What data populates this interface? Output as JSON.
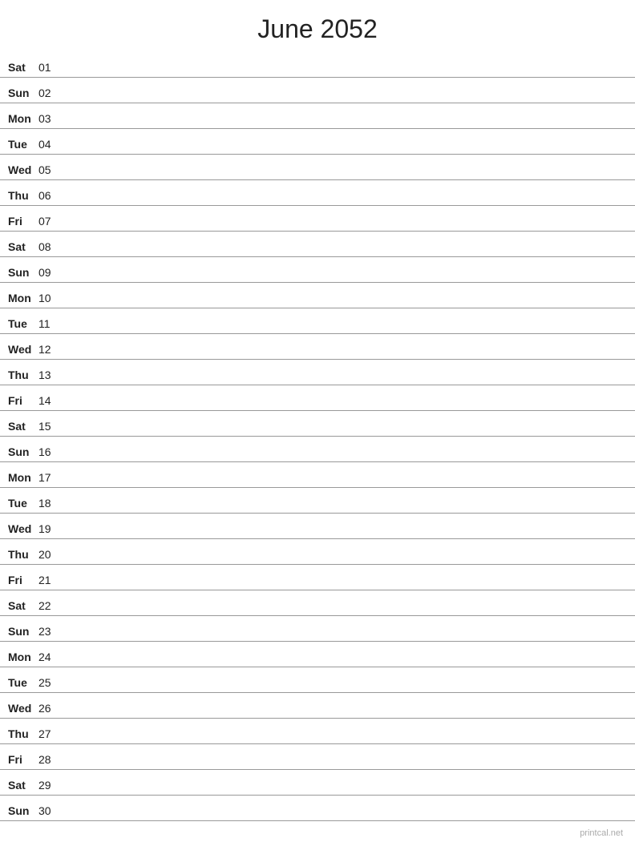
{
  "header": {
    "title": "June 2052"
  },
  "footer": {
    "text": "printcal.net"
  },
  "days": [
    {
      "day": "Sat",
      "num": "01"
    },
    {
      "day": "Sun",
      "num": "02"
    },
    {
      "day": "Mon",
      "num": "03"
    },
    {
      "day": "Tue",
      "num": "04"
    },
    {
      "day": "Wed",
      "num": "05"
    },
    {
      "day": "Thu",
      "num": "06"
    },
    {
      "day": "Fri",
      "num": "07"
    },
    {
      "day": "Sat",
      "num": "08"
    },
    {
      "day": "Sun",
      "num": "09"
    },
    {
      "day": "Mon",
      "num": "10"
    },
    {
      "day": "Tue",
      "num": "11"
    },
    {
      "day": "Wed",
      "num": "12"
    },
    {
      "day": "Thu",
      "num": "13"
    },
    {
      "day": "Fri",
      "num": "14"
    },
    {
      "day": "Sat",
      "num": "15"
    },
    {
      "day": "Sun",
      "num": "16"
    },
    {
      "day": "Mon",
      "num": "17"
    },
    {
      "day": "Tue",
      "num": "18"
    },
    {
      "day": "Wed",
      "num": "19"
    },
    {
      "day": "Thu",
      "num": "20"
    },
    {
      "day": "Fri",
      "num": "21"
    },
    {
      "day": "Sat",
      "num": "22"
    },
    {
      "day": "Sun",
      "num": "23"
    },
    {
      "day": "Mon",
      "num": "24"
    },
    {
      "day": "Tue",
      "num": "25"
    },
    {
      "day": "Wed",
      "num": "26"
    },
    {
      "day": "Thu",
      "num": "27"
    },
    {
      "day": "Fri",
      "num": "28"
    },
    {
      "day": "Sat",
      "num": "29"
    },
    {
      "day": "Sun",
      "num": "30"
    }
  ]
}
